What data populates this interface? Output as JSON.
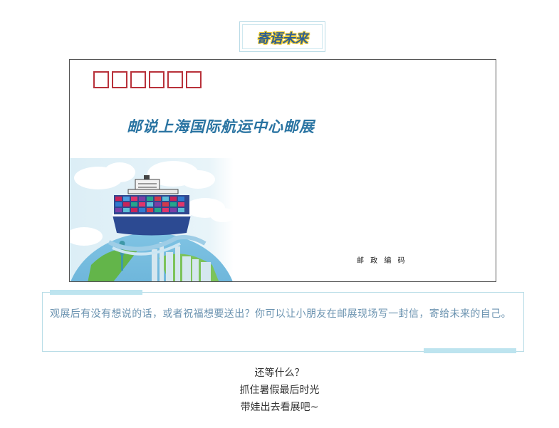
{
  "title": "寄语未来",
  "envelope": {
    "title": "邮说上海国际航运中心邮展",
    "postcode_label": "邮 政 编 码",
    "postcode_box_count": 6
  },
  "note": {
    "text": "观展后有没有想说的话，或者祝福想要送出？你可以让小朋友在邮展现场写一封信，寄给未来的自己。"
  },
  "closing": {
    "line1": "还等什么？",
    "line2": "抓住暑假最后时光",
    "line3": "带娃出去看展吧~"
  },
  "colors": {
    "title_text": "#2f5f92",
    "title_outline": "#f2cc2b",
    "postcode_red": "#b8313a",
    "envelope_title": "#2a74a2",
    "note_text": "#6b93b0",
    "accent": "#bde4ef"
  }
}
